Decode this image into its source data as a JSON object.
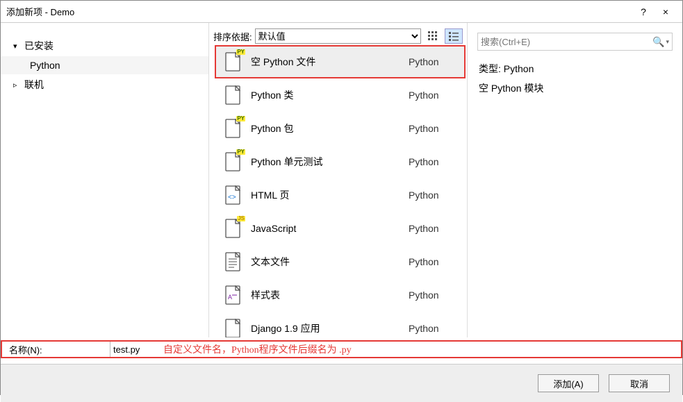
{
  "window": {
    "title": "添加新项 - Demo",
    "help": "?",
    "close": "×"
  },
  "sidebar": {
    "installed_label": "已安装",
    "python_label": "Python",
    "online_label": "联机"
  },
  "sortbar": {
    "label": "排序依据:",
    "value": "默认值"
  },
  "templates": [
    {
      "name": "空 Python 文件",
      "cat": "Python",
      "icon": "file-py",
      "selected": true
    },
    {
      "name": "Python 类",
      "cat": "Python",
      "icon": "file-plain"
    },
    {
      "name": "Python 包",
      "cat": "Python",
      "icon": "file-py"
    },
    {
      "name": "Python 单元测试",
      "cat": "Python",
      "icon": "file-py"
    },
    {
      "name": "HTML 页",
      "cat": "Python",
      "icon": "file-html"
    },
    {
      "name": "JavaScript",
      "cat": "Python",
      "icon": "file-js"
    },
    {
      "name": "文本文件",
      "cat": "Python",
      "icon": "file-text"
    },
    {
      "name": "样式表",
      "cat": "Python",
      "icon": "file-css"
    },
    {
      "name": "Django 1.9 应用",
      "cat": "Python",
      "icon": "file-plain"
    }
  ],
  "search": {
    "placeholder": "搜索(Ctrl+E)"
  },
  "details": {
    "type_label": "类型:",
    "type_value": "Python",
    "desc": "空 Python 模块"
  },
  "name_field": {
    "label": "名称(N):",
    "value": "test.py",
    "annotation": "自定义文件名，Python程序文件后缀名为 .py"
  },
  "buttons": {
    "add": "添加(A)",
    "cancel": "取消"
  }
}
